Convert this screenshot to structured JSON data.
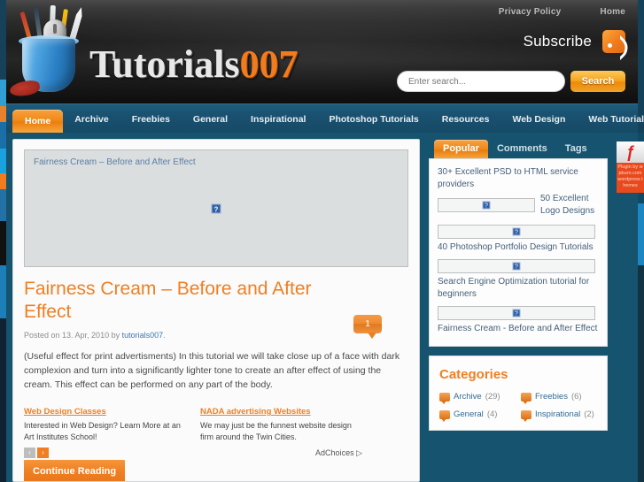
{
  "site": {
    "title_part1": "Tutorials",
    "title_part2": "007",
    "logo_icon": "pencil-cup-icon"
  },
  "topbar": {
    "links": [
      {
        "label": "Privacy Policy"
      },
      {
        "label": "Home"
      }
    ]
  },
  "subscribe": {
    "label": "Subscribe",
    "icon": "rss-icon"
  },
  "search": {
    "placeholder": "Enter search...",
    "value": "",
    "button_label": "Search"
  },
  "nav": {
    "items": [
      {
        "label": "Home",
        "active": true
      },
      {
        "label": "Archive",
        "active": false
      },
      {
        "label": "Freebies",
        "active": false
      },
      {
        "label": "General",
        "active": false
      },
      {
        "label": "Inspirational",
        "active": false
      },
      {
        "label": "Photoshop Tutorials",
        "active": false
      },
      {
        "label": "Resources",
        "active": false
      },
      {
        "label": "Web Design",
        "active": false
      },
      {
        "label": "Web Tutorials",
        "active": false
      }
    ]
  },
  "post": {
    "featured_image_alt": "Fairness Cream – Before and After Effect",
    "broken_image_glyph": "?",
    "title": "Fairness Cream – Before and After Effect",
    "comment_count": "1",
    "meta_prefix": "Posted on 13. Apr, 2010 by ",
    "meta_author": "tutorials007",
    "meta_suffix": ".",
    "excerpt": "(Useful effect for print advertisments) In this tutorial we will take close up of a face with dark complexion and turn into a significantly lighter tone to create an after effect of using the cream. This effect can be performed on any part of the body.",
    "continue_label": "Continue Reading"
  },
  "ads": {
    "items": [
      {
        "title": "Web Design Classes",
        "text": "Interested in Web Design? Learn More at an Art Institutes School!"
      },
      {
        "title": "NADA advertising Websites",
        "text": "We may just be the funnest website design firm around the Twin Cities."
      }
    ],
    "prev_glyph": "‹",
    "next_glyph": "›",
    "adchoices_label": "AdChoices ▷"
  },
  "sidebar": {
    "tabs": [
      {
        "label": "Popular",
        "active": true
      },
      {
        "label": "Comments",
        "active": false
      },
      {
        "label": "Tags",
        "active": false
      }
    ],
    "popular_items": [
      {
        "text": "30+ Excellent PSD to HTML service providers",
        "has_thumb": false
      },
      {
        "text": "50 Excellent Logo Designs",
        "has_thumb": true
      },
      {
        "text": "40 Photoshop Portfolio Design Tutorials",
        "has_thumb": true
      },
      {
        "text": "Search Engine Optimization tutorial for beginners",
        "has_thumb": true
      },
      {
        "text": "Fairness Cream - Before and After Effect",
        "has_thumb": true
      }
    ],
    "thumb_glyph": "?",
    "categories_title": "Categories",
    "categories": [
      {
        "name": "Archive",
        "count": "(29)"
      },
      {
        "name": "Freebies",
        "count": "(6)"
      },
      {
        "name": "General",
        "count": "(4)"
      },
      {
        "name": "Inspirational",
        "count": "(2)"
      }
    ]
  },
  "plugin_badge": {
    "icon": "flash-icon",
    "glyph": "ƒ",
    "text": "Plugin by wpburn.com wordpress themes"
  },
  "colors": {
    "accent_orange": "#ef7f22",
    "nav_blue": "#1a5170",
    "page_blue": "#15536f",
    "link_blue": "#3a78b5"
  }
}
